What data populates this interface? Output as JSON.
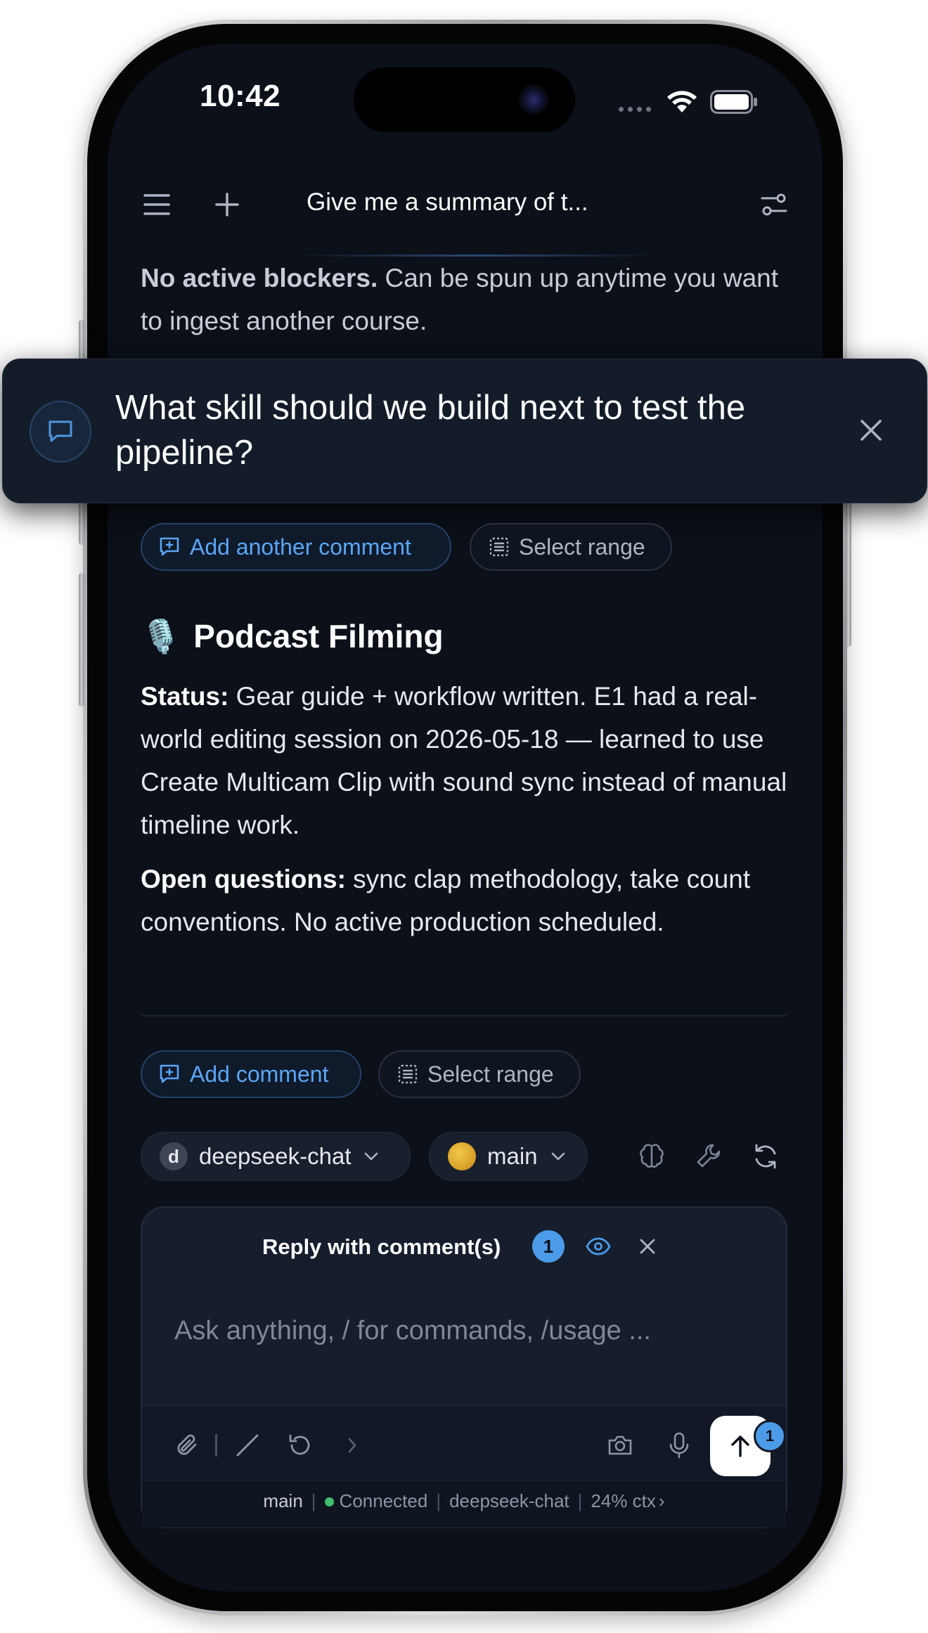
{
  "status_bar": {
    "time": "10:42"
  },
  "nav": {
    "title": "Give me a summary of t..."
  },
  "prev_section": {
    "blocker_bold": "No active blockers.",
    "blocker_rest": " Can be spun up anytime you want to ingest another course."
  },
  "overlay": {
    "text": "What skill should we build next to test the pipeline?"
  },
  "actions_1": {
    "add_label": "Add another comment",
    "range_label": "Select range"
  },
  "podcast": {
    "emoji": "🎙️",
    "heading": "Podcast Filming",
    "status_label": "Status:",
    "status_text": " Gear guide + workflow written. E1 had a real-world editing session on 2026-05-18 — learned to use Create Multicam Clip with sound sync instead of manual timeline work.",
    "open_label": "Open questions:",
    "open_text": " sync clap methodology, take count conventions. No active production scheduled."
  },
  "actions_2": {
    "add_label": "Add comment",
    "range_label": "Select range"
  },
  "model_bar": {
    "model_initial": "d",
    "model_name": "deepseek-chat",
    "branch_name": "main"
  },
  "composer": {
    "reply_title": "Reply with comment(s)",
    "reply_count": "1",
    "placeholder": "Ask anything, / for commands, /usage ...",
    "send_badge": "1"
  },
  "footer": {
    "branch": "main",
    "connection": "Connected",
    "model": "deepseek-chat",
    "context": "24% ctx"
  },
  "colors": {
    "accent": "#5aa6f5",
    "background": "#0b1019",
    "connected": "#3fbf6e"
  }
}
